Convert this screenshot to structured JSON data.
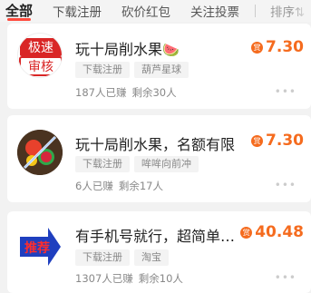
{
  "tabs": [
    {
      "label": "全部",
      "active": true
    },
    {
      "label": "下载注册"
    },
    {
      "label": "砍价红包"
    },
    {
      "label": "关注投票"
    }
  ],
  "sort_label": "排序⇅",
  "tasks": [
    {
      "thumb_text": [
        "极速",
        "审核"
      ],
      "title": "玩十局削水果",
      "title_emoji": "🍉",
      "tags": [
        "下载注册",
        "葫芦星球"
      ],
      "earned": "187人已赚",
      "remaining": "剩余30人",
      "price_badge": "赏",
      "price": "7.30",
      "more": "•••"
    },
    {
      "thumb_icon": "fruit-ninja-icon",
      "title": "玩十局削水果，名额有限",
      "tags": [
        "下载注册",
        "哞哞向前冲"
      ],
      "earned": "6人已赚",
      "remaining": "剩余17人",
      "price_badge": "赏",
      "price": "7.30",
      "more": "•••"
    },
    {
      "thumb_text": [
        "推荐"
      ],
      "title": "有手机号就行，超简单…",
      "tags": [
        "下载注册",
        "淘宝"
      ],
      "earned": "1307人已赚",
      "remaining": "剩余10人",
      "price_badge": "赏",
      "price": "40.48",
      "more": "•••"
    }
  ],
  "colors": {
    "accent": "#ff4a3d",
    "price": "#f56b1e"
  }
}
